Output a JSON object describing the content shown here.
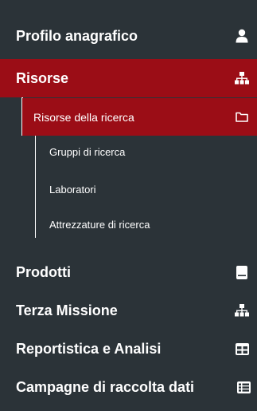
{
  "menu": {
    "profilo": {
      "label": "Profilo anagrafico",
      "icon": "user-icon"
    },
    "risorse": {
      "label": "Risorse",
      "icon": "sitemap-icon"
    },
    "risorse_ricerca": {
      "label": "Risorse della ricerca",
      "icon": "folder-icon"
    },
    "gruppi": {
      "label": "Gruppi di ricerca"
    },
    "laboratori": {
      "label": "Laboratori"
    },
    "attrezzature": {
      "label": "Attrezzature di ricerca"
    },
    "prodotti": {
      "label": "Prodotti",
      "icon": "book-icon"
    },
    "terza": {
      "label": "Terza Missione",
      "icon": "sitemap-icon"
    },
    "reportistica": {
      "label": "Reportistica e Analisi",
      "icon": "table-icon"
    },
    "campagne": {
      "label": "Campagne di raccolta dati",
      "icon": "list-icon"
    }
  },
  "colors": {
    "sidebar_bg": "#2b3338",
    "active_bg": "#9b0d16",
    "text": "#ffffff"
  }
}
